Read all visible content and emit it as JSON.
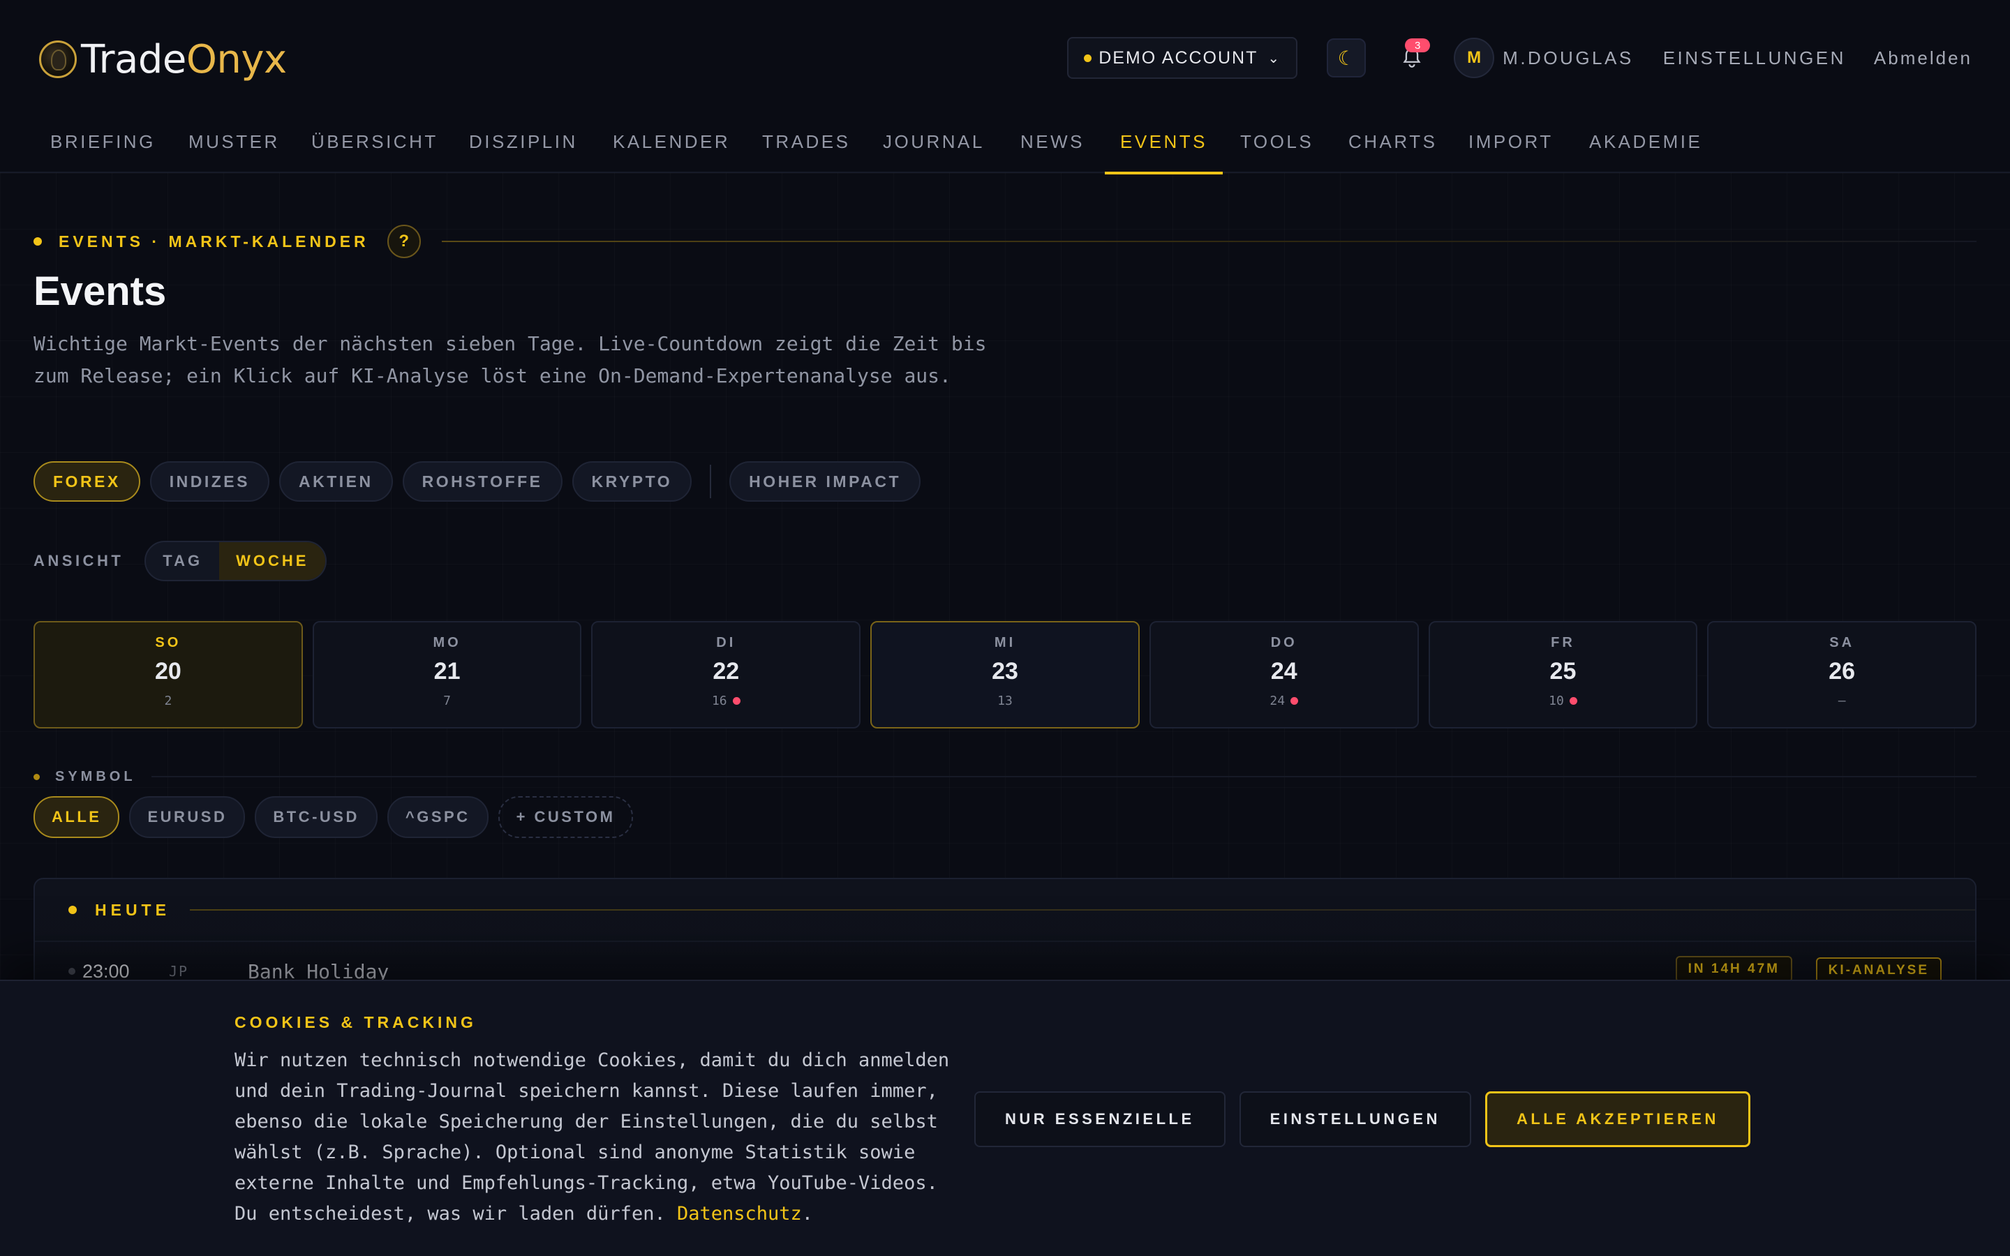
{
  "app": {
    "logo_part1": "Trade",
    "logo_part2": "Onyx"
  },
  "header": {
    "account_label": "DEMO ACCOUNT",
    "notifications_count": "3",
    "avatar_initial": "M",
    "user_name": "M.DOUGLAS",
    "settings_label": "EINSTELLUNGEN",
    "logout_label": "Abmelden"
  },
  "nav": {
    "items": [
      "BRIEFING",
      "MUSTER",
      "ÜBERSICHT",
      "DISZIPLIN",
      "KALENDER",
      "TRADES",
      "JOURNAL",
      "NEWS",
      "EVENTS",
      "TOOLS",
      "CHARTS",
      "IMPORT",
      "AKADEMIE"
    ],
    "active": "EVENTS"
  },
  "page": {
    "eyebrow": "EVENTS · MARKT-KALENDER",
    "help": "?",
    "title": "Events",
    "description": "Wichtige Markt-Events der nächsten sieben Tage. Live-Countdown zeigt die Zeit bis zum Release; ein Klick auf KI-Analyse löst eine On-Demand-Expertenanalyse aus."
  },
  "categories": {
    "items": [
      "FOREX",
      "INDIZES",
      "AKTIEN",
      "ROHSTOFFE",
      "KRYPTO"
    ],
    "high_impact": "HOHER IMPACT",
    "active": "FOREX"
  },
  "view": {
    "label": "ANSICHT",
    "options": [
      "TAG",
      "WOCHE"
    ],
    "active": "WOCHE"
  },
  "days": [
    {
      "name": "SO",
      "num": "20",
      "count": "2",
      "high_impact": false,
      "state": "today"
    },
    {
      "name": "MO",
      "num": "21",
      "count": "7",
      "high_impact": false,
      "state": ""
    },
    {
      "name": "DI",
      "num": "22",
      "count": "16",
      "high_impact": true,
      "state": ""
    },
    {
      "name": "MI",
      "num": "23",
      "count": "13",
      "high_impact": false,
      "state": "selected"
    },
    {
      "name": "DO",
      "num": "24",
      "count": "24",
      "high_impact": true,
      "state": ""
    },
    {
      "name": "FR",
      "num": "25",
      "count": "10",
      "high_impact": true,
      "state": ""
    },
    {
      "name": "SA",
      "num": "26",
      "count": "—",
      "high_impact": false,
      "state": ""
    }
  ],
  "symbol": {
    "label": "SYMBOL",
    "items": [
      "ALLE",
      "EURUSD",
      "BTC-USD",
      "^GSPC"
    ],
    "custom": "+ CUSTOM",
    "active": "ALLE"
  },
  "today_section": {
    "title": "HEUTE",
    "events": [
      {
        "time": "23:00",
        "country": "JP",
        "name": "Bank Holiday",
        "countdown": "IN 14H 47M",
        "ai_label": "KI-ANALYSE"
      }
    ]
  },
  "cookie": {
    "title": "COOKIES & TRACKING",
    "text": "Wir nutzen technisch notwendige Cookies, damit du dich anmelden und dein Trading-Journal speichern kannst. Diese laufen immer, ebenso die lokale Speicherung der Einstellungen, die du selbst wählst (z.B. Sprache). Optional sind anonyme Statistik sowie externe Inhalte und Empfehlungs-Tracking, etwa YouTube-Videos. Du entscheidest, was wir laden dürfen.",
    "link": "Datenschutz",
    "link_suffix": ".",
    "btn_essential": "NUR ESSENZIELLE",
    "btn_settings": "EINSTELLUNGEN",
    "btn_accept": "ALLE AKZEPTIEREN"
  },
  "colors": {
    "accent": "#f2c418",
    "alert": "#ff4d6d",
    "background": "#0a0c14"
  }
}
